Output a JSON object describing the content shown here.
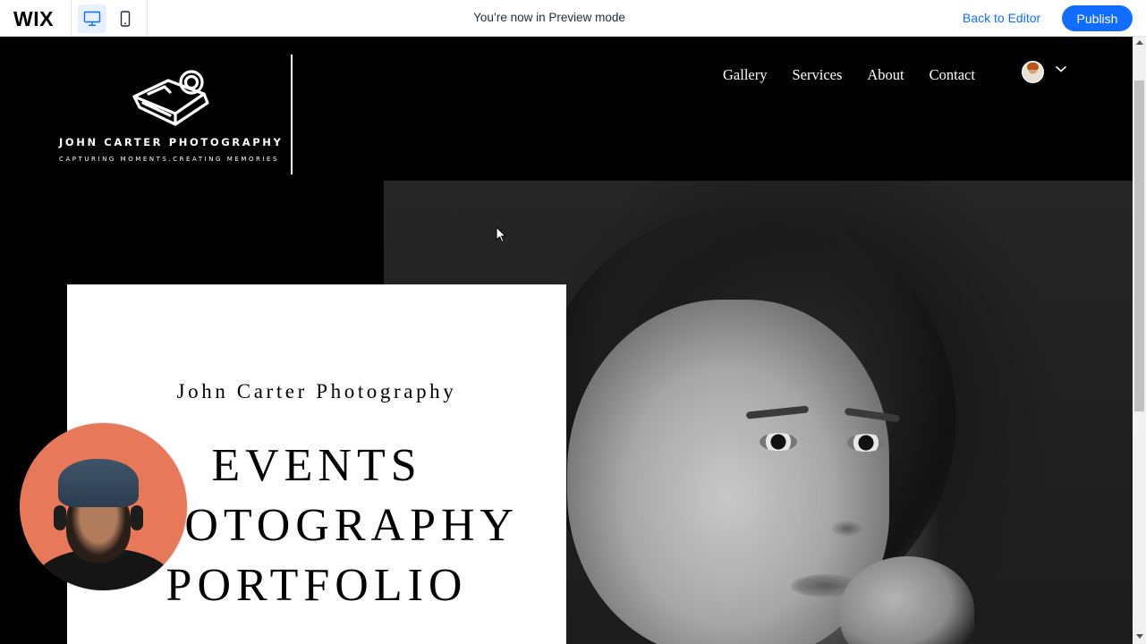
{
  "topbar": {
    "logo": "WIX",
    "preview_message": "You’re now in Preview mode",
    "back_label": "Back to Editor",
    "publish_label": "Publish",
    "accent": "#116dff",
    "icons": [
      "desktop-icon",
      "mobile-icon"
    ]
  },
  "site": {
    "brand_name": "JOHN CARTER PHOTOGRAPHY",
    "tagline": "CAPTURING MOMENTS.CREATING MEMORIES",
    "nav": [
      "Gallery",
      "Services",
      "About",
      "Contact"
    ],
    "card": {
      "subtitle": "John Carter Photography",
      "title_lines": [
        "EVENTS",
        "PHOTOGRAPHY",
        "PORTFOLIO"
      ]
    }
  }
}
